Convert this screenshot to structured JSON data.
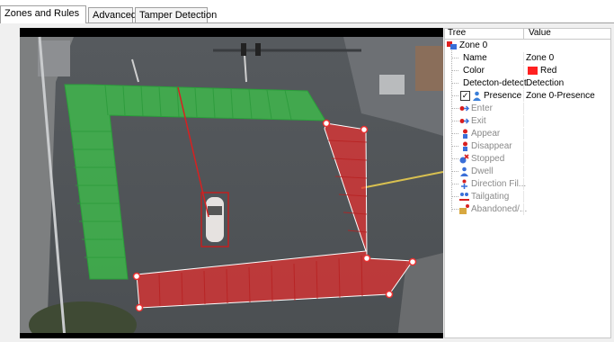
{
  "tabs": [
    {
      "label": "Zones and Rules",
      "active": true
    },
    {
      "label": "Advanced",
      "active": false
    },
    {
      "label": "Tamper Detection",
      "active": false
    }
  ],
  "tree": {
    "columns": [
      "Tree",
      "Value"
    ],
    "root": {
      "label": "Zone 0",
      "icon": "zone-icon"
    },
    "properties": [
      {
        "key": "Name",
        "value": "Zone 0"
      },
      {
        "key": "Color",
        "value": "Red",
        "color": "#ff2020"
      },
      {
        "key": "Detecton-detect",
        "value": "Detection"
      }
    ],
    "rules": [
      {
        "label": "Presence",
        "value": "Zone 0-Presence",
        "checked": true,
        "enabled": true,
        "icon": "person-icon"
      },
      {
        "label": "Enter",
        "enabled": false,
        "icon": "enter-arrow-icon"
      },
      {
        "label": "Exit",
        "enabled": false,
        "icon": "exit-arrow-icon"
      },
      {
        "label": "Appear",
        "enabled": false,
        "icon": "appear-icon"
      },
      {
        "label": "Disappear",
        "enabled": false,
        "icon": "disappear-icon"
      },
      {
        "label": "Stopped",
        "enabled": false,
        "icon": "stopped-icon"
      },
      {
        "label": "Dwell",
        "enabled": false,
        "icon": "dwell-icon"
      },
      {
        "label": "Direction Fil...",
        "enabled": false,
        "icon": "direction-filter-icon"
      },
      {
        "label": "Tailgating",
        "enabled": false,
        "icon": "tailgating-icon"
      },
      {
        "label": "Abandoned/...",
        "enabled": false,
        "icon": "abandoned-icon"
      }
    ]
  },
  "video": {
    "zones": [
      {
        "name": "green-zone",
        "color": "#3cc84a"
      },
      {
        "name": "red-zone",
        "color": "#e83030"
      }
    ]
  }
}
